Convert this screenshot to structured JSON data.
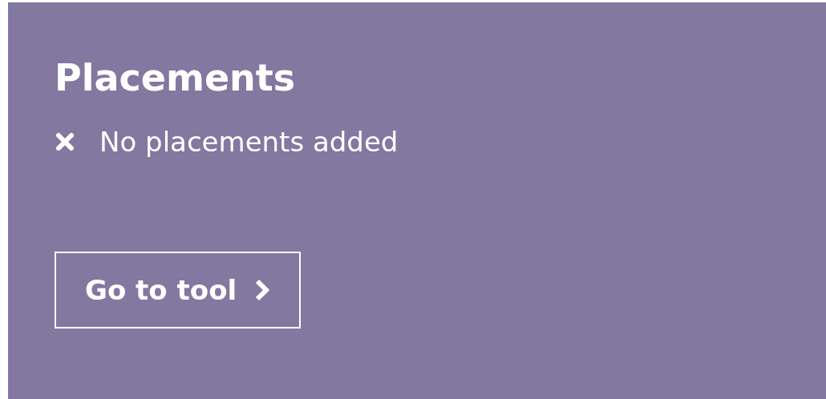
{
  "card": {
    "title": "Placements",
    "status": {
      "text": "No placements added"
    },
    "button": {
      "label": "Go to tool"
    }
  }
}
